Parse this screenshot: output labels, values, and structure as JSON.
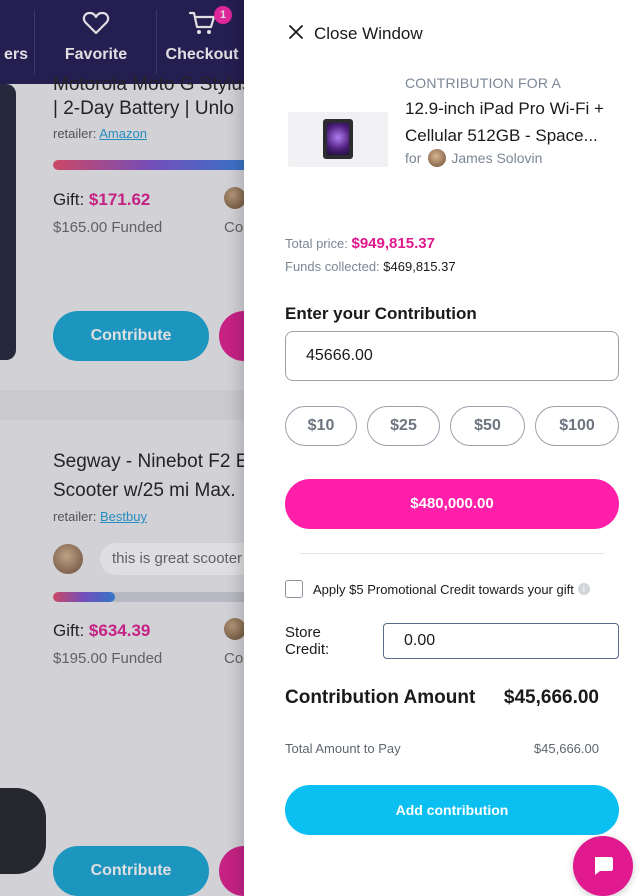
{
  "background": {
    "nav": {
      "items": [
        {
          "label": "ers",
          "icon": "none"
        },
        {
          "label": "Favorite",
          "icon": "heart-icon"
        },
        {
          "label": "Checkout",
          "icon": "cart-icon",
          "badge": "1"
        }
      ]
    },
    "card1": {
      "title_line1": "Motorola Moto G Stylus",
      "title_line2": "| 2-Day Battery | Unlo",
      "retailer_label": "retailer:",
      "retailer_name": "Amazon",
      "gift_label": "Gift:",
      "gift_amount": "$171.62",
      "funded": "$165.00 Funded",
      "co_text": "Co",
      "contribute_label": "Contribute",
      "progress": 1.0
    },
    "card2": {
      "title_line1": "Segway - Ninebot F2 E",
      "title_line2": "Scooter w/25 mi Max.",
      "retailer_label": "retailer:",
      "retailer_name": "Bestbuy",
      "comment": "this is great scooter",
      "gift_label": "Gift:",
      "gift_amount": "$634.39",
      "funded": "$195.00 Funded",
      "co_text": "Co",
      "contribute_label": "Contribute",
      "progress": 0.31
    }
  },
  "drawer": {
    "close_label": "Close Window",
    "contribution_for": "CONTRIBUTION FOR A",
    "item_name": "12.9-inch iPad Pro Wi-Fi + Cellular 512GB - Space...",
    "for_label": "for",
    "recipient": "James Solovin",
    "total_price_label": "Total price:",
    "total_price": "$949,815.37",
    "funds_label": "Funds collected:",
    "funds_collected": "$469,815.37",
    "enter_label": "Enter your Contribution",
    "contribution_input": "45666.00",
    "presets": [
      "$10",
      "$25",
      "$50",
      "$100"
    ],
    "total_button": "$480,000.00",
    "promo_label": "Apply $5 Promotional Credit towards your gift",
    "promo_checked": false,
    "store_credit_label": "Store Credit:",
    "store_credit_value": "0.00",
    "contribution_amount_label": "Contribution Amount",
    "contribution_amount": "$45,666.00",
    "total_pay_label": "Total Amount to Pay",
    "total_pay": "$45,666.00",
    "add_button": "Add contribution"
  },
  "colors": {
    "nav_bg": "#1d1450",
    "pink": "#e0198e",
    "pink_button": "#ff1fa8",
    "blue_button": "#0bbff0",
    "contribute_blue": "#12a6d6"
  }
}
